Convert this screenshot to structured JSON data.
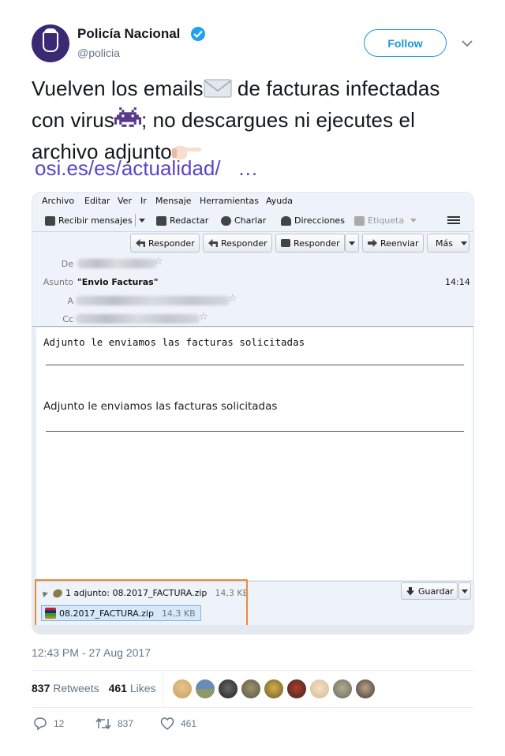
{
  "account": {
    "display_name": "Policía Nacional",
    "handle": "@policia",
    "follow_label": "Follow"
  },
  "tweet": {
    "line1_a": "Vuelven los emails",
    "line1_b": " de facturas infectadas",
    "line2_a": "con virus",
    "line2_b": "; no descargues ni ejecutes el",
    "line3": "archivo adjunto",
    "link": "osi.es/es/actualidad/",
    "link_ellipsis": "…",
    "timestamp": "12:43 PM - 27 Aug 2017"
  },
  "stats": {
    "retweets_count": "837",
    "retweets_label": "Retweets",
    "likes_count": "461",
    "likes_label": "Likes"
  },
  "actions": {
    "reply_count": "12",
    "retweet_count": "837",
    "like_count": "461"
  },
  "email_client": {
    "menu": [
      "Archivo",
      "Editar",
      "Ver",
      "Ir",
      "Mensaje",
      "Herramientas",
      "Ayuda"
    ],
    "toolbar": {
      "get_mail": "Recibir mensajes",
      "write": "Redactar",
      "chat": "Charlar",
      "addresses": "Direcciones",
      "tag": "Etiqueta"
    },
    "reply_buttons": {
      "reply": "Responder",
      "reply_all": "Responder",
      "reply_list": "Responder",
      "forward": "Reenviar",
      "more": "Más"
    },
    "header_labels": {
      "from": "De",
      "subject": "Asunto",
      "to": "A",
      "cc": "Cc"
    },
    "subject": "\"Envio Facturas\"",
    "time": "14:14",
    "body_mono": "Adjunto le enviamos las facturas solicitadas",
    "body_sans": "Adjunto le enviamos las facturas solicitadas",
    "attachment": {
      "summary": "1 adjunto: 08.2017_FACTURA.zip",
      "summary_size": "14,3 KB",
      "file_name": "08.2017_FACTURA.zip",
      "file_size": "14,3 KB",
      "save_label": "Guardar"
    }
  },
  "colors": {
    "accent": "#1b95e0",
    "link": "#5b45c9",
    "highlight_box": "#f0883a"
  }
}
